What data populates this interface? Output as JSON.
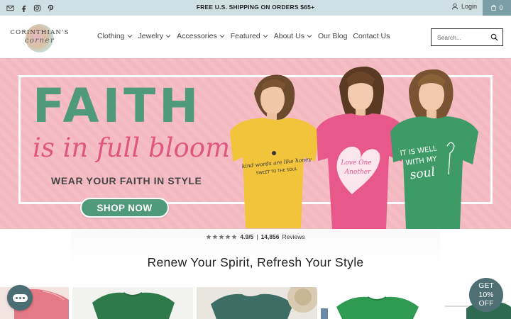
{
  "topbar": {
    "shipping": "FREE U.S. SHIPPING ON ORDERS $65+",
    "login": "Login",
    "cart_count": "0",
    "social_icons": [
      "mail-icon",
      "facebook-icon",
      "instagram-icon",
      "pinterest-icon"
    ],
    "bg_color": "#cfe0e4",
    "cart_bg_color": "#7b9ea6"
  },
  "header": {
    "logo_line1": "CORINTHIAN'S",
    "logo_line2": "corner",
    "nav": [
      {
        "label": "Clothing",
        "dropdown": true
      },
      {
        "label": "Jewelry",
        "dropdown": true
      },
      {
        "label": "Accessories",
        "dropdown": true
      },
      {
        "label": "Featured",
        "dropdown": true
      },
      {
        "label": "About Us",
        "dropdown": true
      },
      {
        "label": "Our Blog",
        "dropdown": false
      },
      {
        "label": "Contact Us",
        "dropdown": false
      }
    ],
    "search_placeholder": "Search..."
  },
  "hero": {
    "headline": "FAITH",
    "script_line": "is in full bloom",
    "tagline": "WEAR YOUR FAITH IN STYLE",
    "cta": "SHOP NOW",
    "shirts": [
      {
        "text": "kind words are like honey · sweet to the soul",
        "color": "#f2c43c"
      },
      {
        "text": "Love One Another",
        "color": "#e9588a"
      },
      {
        "text": "IT IS WELL WITH MY soul",
        "color": "#3e9a66"
      }
    ],
    "bg_color": "#f4b9c0",
    "accent_color": "#4e9a7a",
    "script_color": "#e0577f"
  },
  "reviews": {
    "rating": "4.9/5",
    "separator": "|",
    "count": "14,856",
    "label": "Reviews",
    "stars": 5
  },
  "section": {
    "title": "Renew Your Spirit, Refresh Your Style"
  },
  "widgets": {
    "discount": [
      "GET",
      "10%",
      "OFF"
    ]
  }
}
